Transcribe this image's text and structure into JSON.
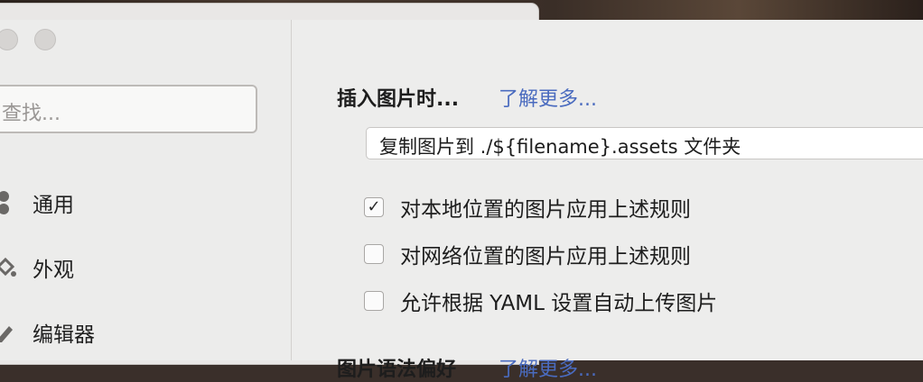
{
  "sidebar": {
    "search_placeholder": "查找...",
    "items": [
      {
        "label": "通用",
        "icon": "general-icon"
      },
      {
        "label": "外观",
        "icon": "appearance-icon"
      },
      {
        "label": "编辑器",
        "icon": "editor-icon"
      }
    ]
  },
  "section": {
    "title": "插入图片时...",
    "learn_more": "了解更多...",
    "select_value": "复制图片到 ./${filename}.assets 文件夹",
    "options": [
      {
        "label": "对本地位置的图片应用上述规则",
        "checked": true
      },
      {
        "label": "对网络位置的图片应用上述规则",
        "checked": false
      },
      {
        "label": "允许根据 YAML 设置自动上传图片",
        "checked": false
      }
    ]
  },
  "next_section": {
    "title": "图片语法偏好",
    "learn_more": "了解更多..."
  },
  "colors": {
    "accent_link": "#4a6bbf",
    "sidebar_bg": "#ececeb",
    "main_bg": "#ededec"
  }
}
